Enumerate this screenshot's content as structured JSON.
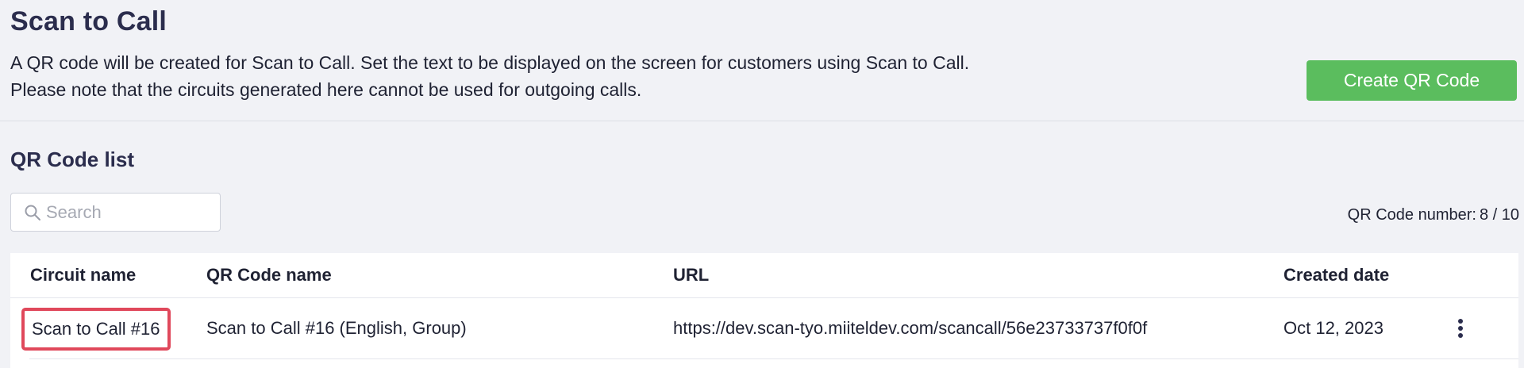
{
  "header": {
    "title": "Scan to Call",
    "description_line1": "A QR code will be created for Scan to Call. Set the text to be displayed on the screen for customers using Scan to Call.",
    "description_line2": "Please note that the circuits generated here cannot be used for outgoing calls.",
    "create_button_label": "Create QR Code"
  },
  "list": {
    "title": "QR Code list",
    "search_placeholder": "Search",
    "count_label": "QR Code number:",
    "count_value": "8 / 10"
  },
  "table": {
    "columns": [
      "Circuit name",
      "QR Code name",
      "URL",
      "Created date"
    ],
    "rows": [
      {
        "circuit_name": "Scan to Call #16",
        "qr_code_name": "Scan to Call #16 (English, Group)",
        "url": "https://dev.scan-tyo.miiteldev.com/scancall/56e23733737f0f0f",
        "created_date": "Oct 12, 2023"
      }
    ]
  },
  "icons": {
    "search": "search-icon",
    "row_menu": "more-vertical-icon"
  },
  "colors": {
    "accent_green": "#5bbd5e",
    "highlight_red": "#e0485b",
    "title_navy": "#2b2d4d"
  }
}
